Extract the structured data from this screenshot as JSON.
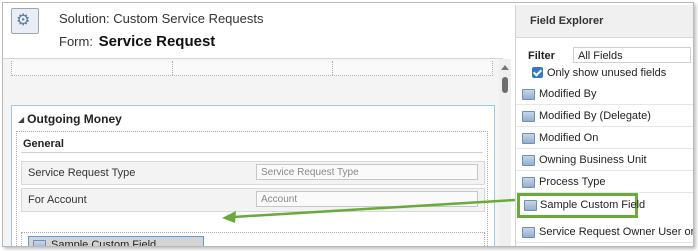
{
  "header": {
    "solution_title": "Solution: Custom Service Requests",
    "form_prefix": "Form:",
    "form_name": "Service Request"
  },
  "form": {
    "tab_label": "Outgoing Money",
    "section_label": "General",
    "fields": [
      {
        "label": "Service Request Type",
        "placeholder": "Service Request Type"
      },
      {
        "label": "For Account",
        "placeholder": "Account"
      }
    ],
    "dropped_field": "Sample Custom Field"
  },
  "field_explorer": {
    "title": "Field Explorer",
    "filter_label": "Filter",
    "filter_value": "All Fields",
    "only_unused_label": "Only show unused fields",
    "only_unused_checked": true,
    "items": [
      "Modified By",
      "Modified By (Delegate)",
      "Modified On",
      "Owning Business Unit",
      "Process Type",
      "Sample Custom Field",
      "Service Request Owner User or Team"
    ],
    "highlighted_item": "Sample Custom Field"
  },
  "colors": {
    "highlight": "#6aaa3a",
    "tab_border": "#9ec7e6",
    "checkbox": "#2f79c6"
  }
}
